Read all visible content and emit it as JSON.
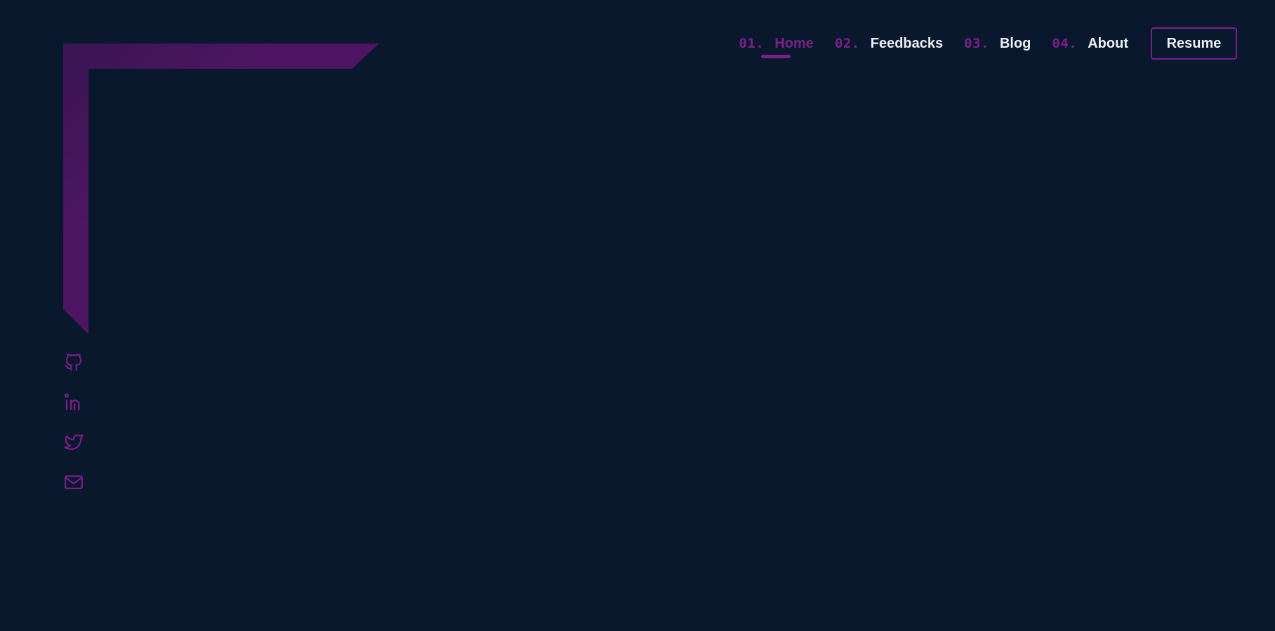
{
  "nav": {
    "items": [
      {
        "num": "01.",
        "label": "Home"
      },
      {
        "num": "02.",
        "label": "Feedbacks"
      },
      {
        "num": "03.",
        "label": "Blog"
      },
      {
        "num": "04.",
        "label": "About"
      }
    ],
    "active_index": 0,
    "resume_label": "Resume"
  },
  "socials": {
    "icons": [
      "github-icon",
      "linkedin-icon",
      "twitter-icon",
      "mail-icon"
    ]
  },
  "colors": {
    "background": "#0a182e",
    "accent": "#7b1f88",
    "frame_dark": "#3a1553",
    "frame_light": "#4e1562",
    "text": "#eef0f5"
  }
}
